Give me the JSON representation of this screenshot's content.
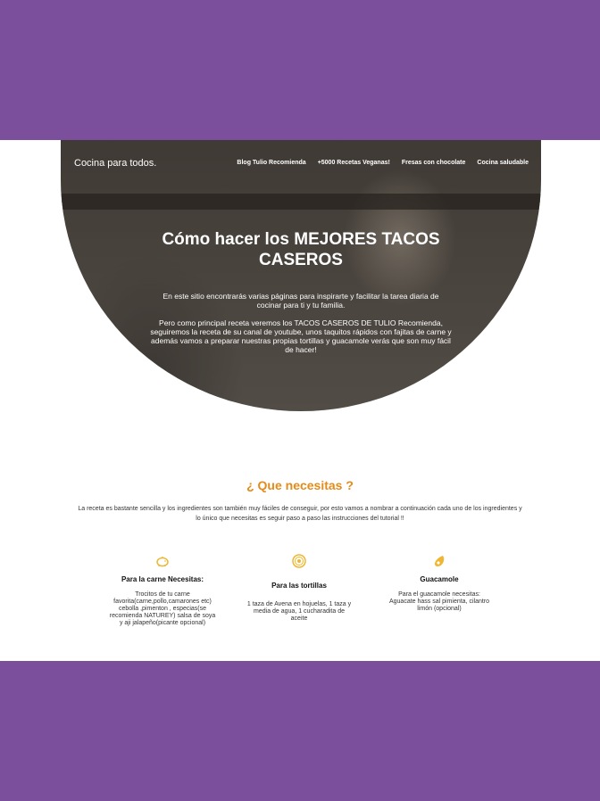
{
  "header": {
    "logo": "Cocina para todos.",
    "nav": [
      "Blog Tulio Recomienda",
      "+5000 Recetas Veganas!",
      "Fresas con chocolate",
      "Cocina saludable"
    ]
  },
  "hero": {
    "title": "Cómo hacer los MEJORES TACOS CASEROS",
    "paragraph1": "En este sitio encontrarás varias páginas para inspirarte y facilitar la tarea diaria de cocinar para ti y tu familia.",
    "paragraph2": "Pero como principal receta veremos los TACOS CASEROS DE TULIO Recomienda, seguiremos la receta de su canal de youtube, unos taquitos rápidos con fajitas de carne y además vamos a preparar nuestras propias tortillas y guacamole verás que son muy fácil de hacer!"
  },
  "section": {
    "title": "¿ Que necesitas ?",
    "intro": "La receta es bastante sencilla y los ingredientes son también muy fáciles de conseguir, por esto vamos a nombrar a continuación cada uno de los ingredientes y lo único que necesitas es seguir paso a paso las instrucciones del tutorial !!"
  },
  "ingredients": [
    {
      "icon": "piggy-bank-icon",
      "title": "Para la carne Necesitas:",
      "text": "Trocitos de tu carne favorita(carne,pollo,camarones etc) cebolla ,pimenton , especias(se recomienda NATUREY) salsa de soya y aji jalapeño(picante opcional)"
    },
    {
      "icon": "tortilla-icon",
      "title": "Para las tortillas",
      "text": "1 taza de Avena en hojuelas, 1 taza y media de agua, 1 cucharadita de aceite"
    },
    {
      "icon": "avocado-icon",
      "title": "Guacamole",
      "text": "Para el guacamole necesitas: Aguacate hass sal pimienta, cilantro limón (opcional)"
    }
  ],
  "colors": {
    "accent": "#e38b1b",
    "background": "#7b4f9c",
    "icon": "#f0b531"
  }
}
